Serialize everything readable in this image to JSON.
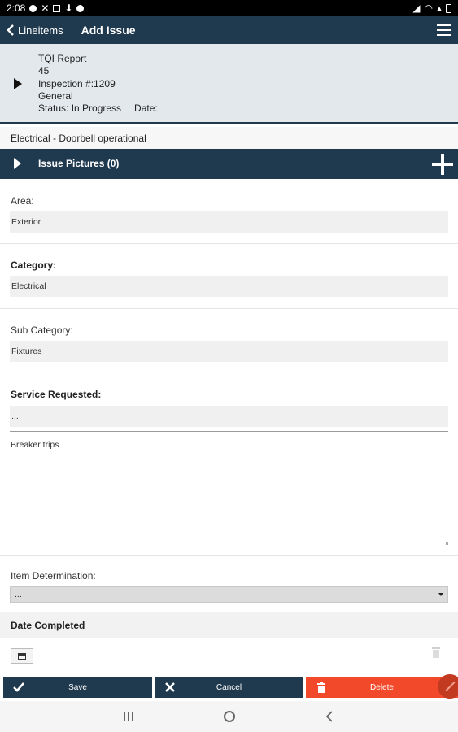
{
  "status_bar": {
    "time": "2:08"
  },
  "app_bar": {
    "back_label": "Lineitems",
    "title": "Add Issue"
  },
  "report": {
    "name": "TQI Report",
    "number": "45",
    "inspection": "Inspection #:1209",
    "type": "General",
    "status": "Status: In Progress",
    "date_label": "Date:"
  },
  "issue_title": "Electrical - Doorbell operational",
  "pictures": {
    "label": "Issue Pictures (0)"
  },
  "fields": {
    "area": {
      "label": "Area:",
      "value": "Exterior"
    },
    "category": {
      "label": "Category:",
      "value": "Electrical"
    },
    "sub_category": {
      "label": "Sub Category:",
      "value": "Fixtures"
    },
    "service_requested": {
      "label": "Service Requested:",
      "value": "...",
      "notes": "Breaker trips"
    },
    "item_determination": {
      "label": "Item Determination:",
      "selected": "..."
    },
    "date_completed": {
      "label": "Date Completed"
    }
  },
  "actions": {
    "save": "Save",
    "cancel": "Cancel",
    "delete": "Delete"
  },
  "colors": {
    "primary": "#1f3a4f",
    "danger": "#f2492a",
    "header_bg": "#e3e8ec"
  }
}
